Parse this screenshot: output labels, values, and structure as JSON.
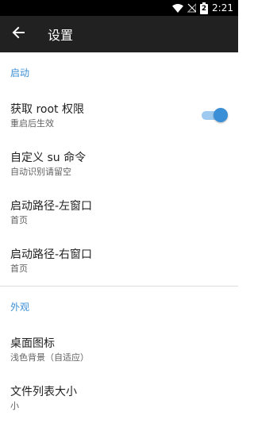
{
  "status_bar": {
    "time": "2:21",
    "battery_level": "2",
    "icons": [
      "wifi-icon",
      "no-signal-icon",
      "battery-icon"
    ]
  },
  "toolbar": {
    "title": "设置",
    "back_icon": "arrow-left-icon"
  },
  "sections": [
    {
      "header": "启动",
      "items": [
        {
          "title": "获取 root 权限",
          "summary": "重启后生效",
          "switch_on": true
        },
        {
          "title": "自定义 su 命令",
          "summary": "自动识别请留空"
        },
        {
          "title": "启动路径-左窗口",
          "summary": "首页"
        },
        {
          "title": "启动路径-右窗口",
          "summary": "首页"
        }
      ]
    },
    {
      "header": "外观",
      "items": [
        {
          "title": "桌面图标",
          "summary": "浅色背景（自适应）"
        },
        {
          "title": "文件列表大小",
          "summary": "小"
        }
      ]
    }
  ],
  "colors": {
    "accent": "#3a8fd6",
    "toolbar": "#212121",
    "status_bar": "#000000"
  }
}
